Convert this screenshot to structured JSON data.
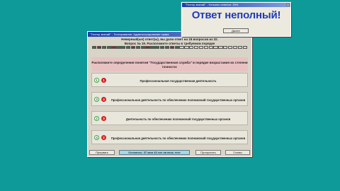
{
  "main_window": {
    "title": "\"Тестер знаний\" - Тестирование: Администрирование права",
    "answered_line": "Неверный(ые) ответ(ы), вы дали ответ на 18 вопросов из 32.",
    "question_line": "Вопрос № 19. Расположите ответы в требуемом порядке",
    "progress_cells": [
      "#2a7a2a",
      "#b31b1b",
      "#2a7a2a",
      "#2a7a2a",
      "#b31b1b",
      "#2a7a2a",
      "#2a7a2a",
      "#2a7a2a",
      "#b31b1b",
      "#2a7a2a",
      "#2a7a2a",
      "#b31b1b",
      "#2a7a2a",
      "#2a7a2a",
      "#2a7a2a",
      "#2a7a2a",
      "#b31b1b",
      "#2a7a2a",
      "#d8d4c8",
      "#d8d4c8",
      "#d8d4c8",
      "#d8d4c8",
      "#d8d4c8",
      "#d8d4c8",
      "#d8d4c8",
      "#d8d4c8",
      "#d8d4c8",
      "#d8d4c8",
      "#d8d4c8",
      "#d8d4c8",
      "#d8d4c8",
      "#d8d4c8"
    ],
    "instruction": "Расположите определения понятия \"Государственная служба\" в порядке возрастания их степени точности:",
    "options": [
      {
        "green": "1",
        "red": "1",
        "text": "Профессиональная государственная деятельность"
      },
      {
        "green": "3",
        "red": "4",
        "text": "Профессиональная деятельность по обеспечению полномочий государственных органов"
      },
      {
        "green": "2",
        "red": "3",
        "text": "Деятельность по обеспечению полномочий государственных органов"
      },
      {
        "green": "4",
        "red": "2",
        "text": "Профессиональная деятельность по обеспечению полномочий государственных органов"
      }
    ],
    "buttons": {
      "prev": "Прервать",
      "skip": "Пропустить",
      "done": "Готово"
    },
    "timer": "Осталось: 37 мин 43 сек на весь тест"
  },
  "popup": {
    "title": "\"Тестер знаний\" - Успешно ответил: 25%",
    "close": "×",
    "message": "Ответ неполный!",
    "ok_label": "Далее"
  }
}
